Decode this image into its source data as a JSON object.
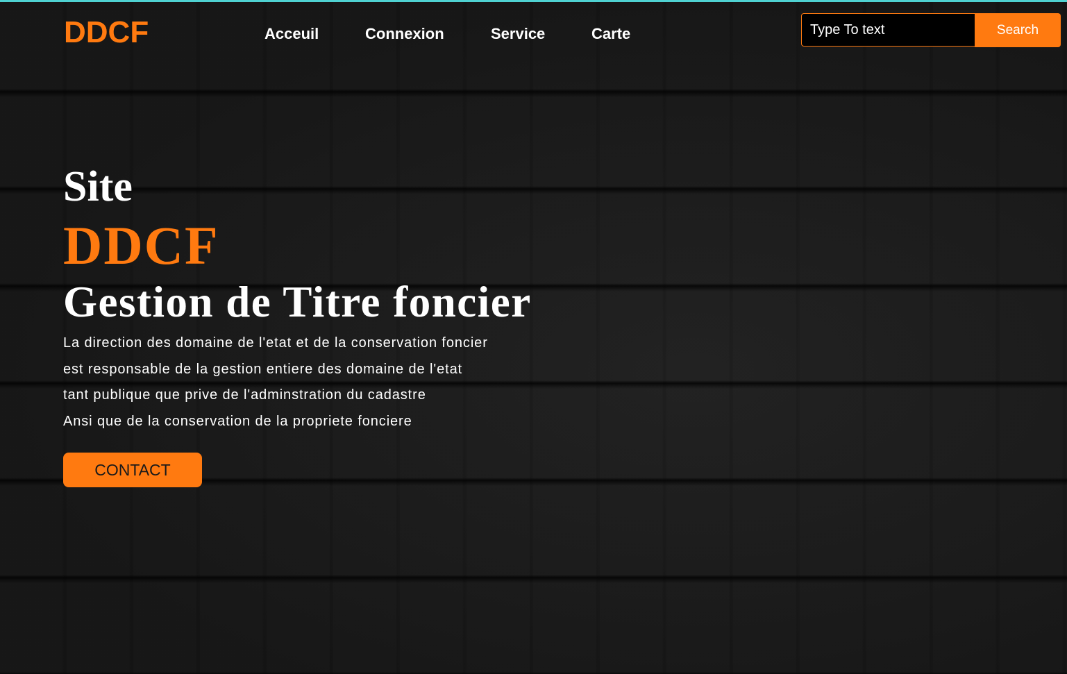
{
  "header": {
    "logo": "DDCF",
    "nav": [
      {
        "label": "Acceuil"
      },
      {
        "label": "Connexion"
      },
      {
        "label": "Service"
      },
      {
        "label": "Carte"
      }
    ],
    "search": {
      "placeholder": "Type To text",
      "button_label": "Search"
    }
  },
  "hero": {
    "line1": "Site",
    "brand": "DDCF",
    "title": "Gestion de Titre foncier",
    "description": [
      "La direction des domaine de l'etat et de la conservation foncier",
      "est responsable de la gestion entiere des domaine de l'etat",
      "tant publique que prive de l'adminstration du cadastre",
      "Ansi que de la conservation de la propriete fonciere"
    ],
    "cta_label": "CONTACT"
  },
  "colors": {
    "accent": "#ff7a10",
    "background": "#171717",
    "top_strip": "#4fd2d2",
    "text": "#ffffff"
  }
}
